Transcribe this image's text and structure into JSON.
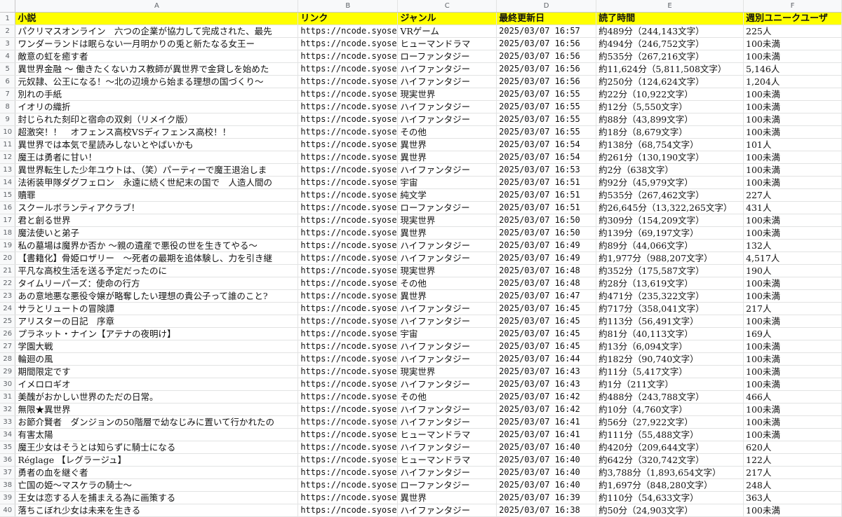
{
  "column_letters": [
    "A",
    "B",
    "C",
    "D",
    "E",
    "F"
  ],
  "header": [
    "小説",
    "リンク",
    "ジャンル",
    "最終更新日",
    "読了時間",
    "週別ユニークユーザ"
  ],
  "rows": [
    [
      "パクリマスオンライン　六つの企業が協力して完成された、最先",
      "https://ncode.syose",
      "VRゲーム",
      "2025/03/07 16:57",
      "約489分（244,143文字）",
      "225人"
    ],
    [
      "ワンダーランドは眠らない一月明かりの兎と新たなる女王ー",
      "https://ncode.syose",
      "ヒューマンドラマ",
      "2025/03/07 16:56",
      "約494分（246,752文字）",
      "100未満"
    ],
    [
      "敵意の虹を癒す者",
      "https://ncode.syose",
      "ローファンタジー",
      "2025/03/07 16:56",
      "約535分（267,216文字）",
      "100未満"
    ],
    [
      "異世界金融 〜 働きたくないカス教師が異世界で金貸しを始めた",
      "https://ncode.syose",
      "ハイファンタジー",
      "2025/03/07 16:56",
      "約11,624分（5,811,508文字）",
      "5,146人"
    ],
    [
      "元奴隷、公王になる！〜北の辺境から始まる理想の国づくり〜",
      "https://ncode.syose",
      "ハイファンタジー",
      "2025/03/07 16:56",
      "約250分（124,624文字）",
      "1,204人"
    ],
    [
      "別れの手紙",
      "https://ncode.syose",
      "現実世界",
      "2025/03/07 16:55",
      "約22分（10,922文字）",
      "100未満"
    ],
    [
      "イオリの織折",
      "https://ncode.syose",
      "ハイファンタジー",
      "2025/03/07 16:55",
      "約12分（5,550文字）",
      "100未満"
    ],
    [
      "封じられた刻印と宿命の双剣（リメイク版）",
      "https://ncode.syose",
      "ハイファンタジー",
      "2025/03/07 16:55",
      "約88分（43,899文字）",
      "100未満"
    ],
    [
      "超激突！！　オフェンス高校VSディフェンス高校！！",
      "https://ncode.syose",
      "その他",
      "2025/03/07 16:55",
      "約18分（8,679文字）",
      "100未満"
    ],
    [
      "異世界では本気で星読みしないとやばいかも",
      "https://ncode.syose",
      "異世界",
      "2025/03/07 16:54",
      "約138分（68,754文字）",
      "101人"
    ],
    [
      "魔王は勇者に甘い！",
      "https://ncode.syose",
      "異世界",
      "2025/03/07 16:54",
      "約261分（130,190文字）",
      "100未満"
    ],
    [
      "異世界転生した少年ユウトは、（笑）パーティーで魔王退治しま",
      "https://ncode.syose",
      "ハイファンタジー",
      "2025/03/07 16:53",
      "約2分（638文字）",
      "100未満"
    ],
    [
      "法術装甲隊ダグフェロン　永遠に続く世紀末の国で　人造人間の",
      "https://ncode.syose",
      "宇宙",
      "2025/03/07 16:51",
      "約92分（45,979文字）",
      "100未満"
    ],
    [
      "贖罪",
      "https://ncode.syose",
      "純文学",
      "2025/03/07 16:51",
      "約535分（267,462文字）",
      "227人"
    ],
    [
      "スクールボランティアクラブ！",
      "https://ncode.syose",
      "ローファンタジー",
      "2025/03/07 16:51",
      "約26,645分（13,322,265文字）",
      "431人"
    ],
    [
      "君と創る世界",
      "https://ncode.syose",
      "現実世界",
      "2025/03/07 16:50",
      "約309分（154,209文字）",
      "100未満"
    ],
    [
      "魔法使いと弟子",
      "https://ncode.syose",
      "異世界",
      "2025/03/07 16:50",
      "約139分（69,197文字）",
      "100未満"
    ],
    [
      "私の墓場は魔界か否か 〜親の遺産で悪役の世を生きてやる〜",
      "https://ncode.syose",
      "ハイファンタジー",
      "2025/03/07 16:49",
      "約89分（44,066文字）",
      "132人"
    ],
    [
      "【書籍化】骨姫ロザリー　〜死者の最期を追体験し、力を引き継",
      "https://ncode.syose",
      "ハイファンタジー",
      "2025/03/07 16:49",
      "約1,977分（988,207文字）",
      "4,517人"
    ],
    [
      "平凡な高校生活を送る予定だったのに",
      "https://ncode.syose",
      "現実世界",
      "2025/03/07 16:48",
      "約352分（175,587文字）",
      "190人"
    ],
    [
      "タイムリーパーズ：使命の行方",
      "https://ncode.syose",
      "その他",
      "2025/03/07 16:48",
      "約28分（13,619文字）",
      "100未満"
    ],
    [
      "あの意地悪な悪役令嬢が略奪したい理想の貴公子って誰のこと?",
      "https://ncode.syose",
      "異世界",
      "2025/03/07 16:47",
      "約471分（235,322文字）",
      "100未満"
    ],
    [
      "サラとリュートの冒険譚",
      "https://ncode.syose",
      "ハイファンタジー",
      "2025/03/07 16:45",
      "約717分（358,041文字）",
      "217人"
    ],
    [
      "アリスターの日記　序章",
      "https://ncode.syose",
      "ハイファンタジー",
      "2025/03/07 16:45",
      "約113分（56,491文字）",
      "100未満"
    ],
    [
      "プラネット・ナイン【アテナの夜明け】",
      "https://ncode.syose",
      "宇宙",
      "2025/03/07 16:45",
      "約81分（40,113文字）",
      "169人"
    ],
    [
      "学園大戦",
      "https://ncode.syose",
      "ハイファンタジー",
      "2025/03/07 16:45",
      "約13分（6,094文字）",
      "100未満"
    ],
    [
      "輪廻の風",
      "https://ncode.syose",
      "ハイファンタジー",
      "2025/03/07 16:44",
      "約182分（90,740文字）",
      "100未満"
    ],
    [
      "期間限定です",
      "https://ncode.syose",
      "現実世界",
      "2025/03/07 16:43",
      "約11分（5,417文字）",
      "100未満"
    ],
    [
      "イメロロギオ",
      "https://ncode.syose",
      "ハイファンタジー",
      "2025/03/07 16:43",
      "約1分（211文字）",
      "100未満"
    ],
    [
      "美醜がおかしい世界のただの日常。",
      "https://ncode.syose",
      "その他",
      "2025/03/07 16:42",
      "約488分（243,788文字）",
      "466人"
    ],
    [
      "無限★異世界",
      "https://ncode.syose",
      "ハイファンタジー",
      "2025/03/07 16:42",
      "約10分（4,760文字）",
      "100未満"
    ],
    [
      "お節介賢者　ダンジョンの50階層で幼なじみに置いて行かれたの",
      "https://ncode.syose",
      "ハイファンタジー",
      "2025/03/07 16:41",
      "約56分（27,922文字）",
      "100未満"
    ],
    [
      "有害太陽",
      "https://ncode.syose",
      "ヒューマンドラマ",
      "2025/03/07 16:41",
      "約111分（55,488文字）",
      "100未満"
    ],
    [
      "魔王少女はそうとは知らずに騎士になる",
      "https://ncode.syose",
      "ハイファンタジー",
      "2025/03/07 16:40",
      "約420分（209,644文字）",
      "620人"
    ],
    [
      "Réglage 【レグラージュ】",
      "https://ncode.syose",
      "ヒューマンドラマ",
      "2025/03/07 16:40",
      "約642分（320,742文字）",
      "122人"
    ],
    [
      "勇者の血を継ぐ者",
      "https://ncode.syose",
      "ハイファンタジー",
      "2025/03/07 16:40",
      "約3,788分（1,893,654文字）",
      "217人"
    ],
    [
      "亡国の姫〜マスケラの騎士〜",
      "https://ncode.syose",
      "ローファンタジー",
      "2025/03/07 16:40",
      "約1,697分（848,280文字）",
      "248人"
    ],
    [
      "王女は恋する人を捕まえる為に画策する",
      "https://ncode.syose",
      "異世界",
      "2025/03/07 16:39",
      "約110分（54,633文字）",
      "363人"
    ],
    [
      "落ちこぼれ少女は未来を生きる",
      "https://ncode.syose",
      "ハイファンタジー",
      "2025/03/07 16:38",
      "約50分（24,903文字）",
      "100未満"
    ]
  ]
}
